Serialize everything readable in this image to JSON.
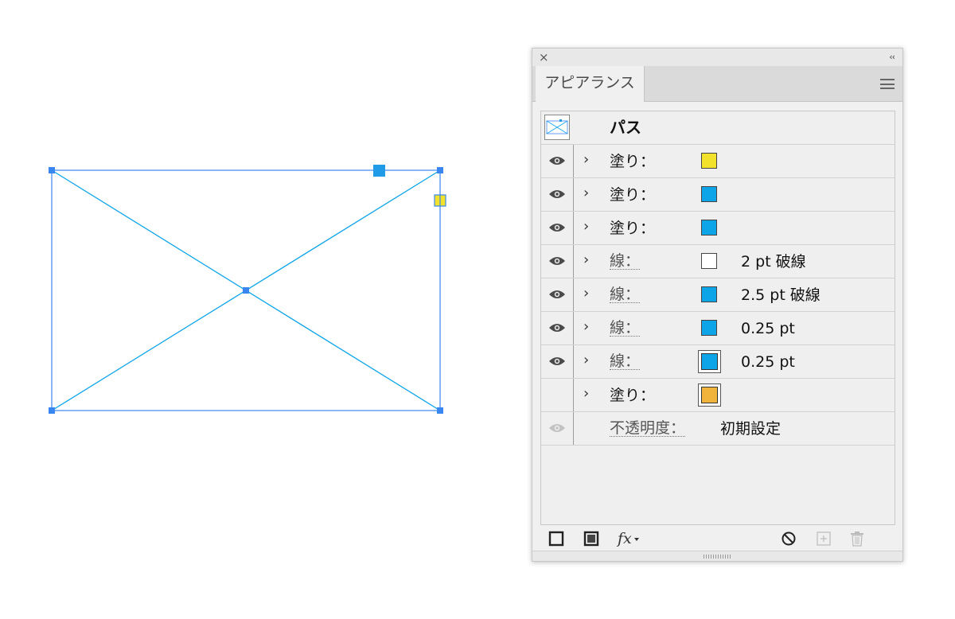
{
  "colors": {
    "selection": "#3a86f0",
    "yellow": "#f3e22b",
    "cyan": "#0ea5e8",
    "white": "#ffffff",
    "orange": "#f0b43c"
  },
  "panel": {
    "tab_label": "アピアランス",
    "close_icon": "×",
    "collapse_icon": "‹‹",
    "object_label": "パス",
    "rows": [
      {
        "label": "塗り：",
        "color": "#f3e22b",
        "value": "",
        "dotted": false,
        "eye": "visible",
        "double": false
      },
      {
        "label": "塗り：",
        "color": "#0ea5e8",
        "value": "",
        "dotted": false,
        "eye": "visible",
        "double": false
      },
      {
        "label": "塗り：",
        "color": "#0ea5e8",
        "value": "",
        "dotted": false,
        "eye": "visible",
        "double": false
      },
      {
        "label": "線：",
        "color": "#ffffff",
        "value": "2 pt 破線",
        "dotted": true,
        "eye": "visible",
        "double": false
      },
      {
        "label": "線：",
        "color": "#0ea5e8",
        "value": "2.5 pt 破線",
        "dotted": true,
        "eye": "visible",
        "double": false
      },
      {
        "label": "線：",
        "color": "#0ea5e8",
        "value": "0.25 pt",
        "dotted": true,
        "eye": "visible",
        "double": false
      },
      {
        "label": "線：",
        "color": "#0ea5e8",
        "value": "0.25 pt",
        "dotted": true,
        "eye": "visible",
        "double": true
      },
      {
        "label": "塗り：",
        "color": "#f0b43c",
        "value": "",
        "dotted": false,
        "eye": "hidden",
        "double": true
      }
    ],
    "opacity": {
      "label": "不透明度：",
      "value": "初期設定"
    },
    "footer_fx": "fx"
  }
}
